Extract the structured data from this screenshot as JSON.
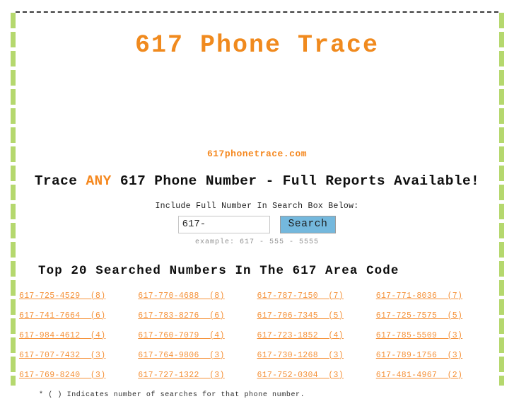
{
  "page": {
    "title": "617 Phone Trace",
    "domain_name": "617phonetrace.com",
    "tagline_before": "Trace ",
    "tagline_highlight": "ANY",
    "tagline_after": " 617 Phone Number - Full Reports Available!",
    "accent_color": "#f5881f",
    "rail_color": "#b5d86e",
    "button_color": "#74b8dd"
  },
  "search": {
    "instruction": "Include Full Number In Search Box Below:",
    "value": "617-",
    "placeholder": "617-",
    "button_label": "Search",
    "example": "example: 617 - 555 - 5555"
  },
  "top_numbers": {
    "heading": "Top 20 Searched Numbers In The 617 Area Code",
    "footnote": "* ( ) Indicates number of searches for that phone number.",
    "rows": [
      [
        {
          "number": "617-725-4529",
          "searches": "(8)",
          "label": "617-725-4529  (8)"
        },
        {
          "number": "617-770-4688",
          "searches": "(8)",
          "label": "617-770-4688  (8)"
        },
        {
          "number": "617-787-7150",
          "searches": "(7)",
          "label": "617-787-7150  (7)"
        },
        {
          "number": "617-771-8036",
          "searches": "(7)",
          "label": "617-771-8036  (7)"
        }
      ],
      [
        {
          "number": "617-741-7664",
          "searches": "(6)",
          "label": "617-741-7664  (6)"
        },
        {
          "number": "617-783-8276",
          "searches": "(6)",
          "label": "617-783-8276  (6)"
        },
        {
          "number": "617-706-7345",
          "searches": "(5)",
          "label": "617-706-7345  (5)"
        },
        {
          "number": "617-725-7575",
          "searches": "(5)",
          "label": "617-725-7575  (5)"
        }
      ],
      [
        {
          "number": "617-984-4612",
          "searches": "(4)",
          "label": "617-984-4612  (4)"
        },
        {
          "number": "617-760-7079",
          "searches": "(4)",
          "label": "617-760-7079  (4)"
        },
        {
          "number": "617-723-1852",
          "searches": "(4)",
          "label": "617-723-1852  (4)"
        },
        {
          "number": "617-785-5509",
          "searches": "(3)",
          "label": "617-785-5509  (3)"
        }
      ],
      [
        {
          "number": "617-707-7432",
          "searches": "(3)",
          "label": "617-707-7432  (3)"
        },
        {
          "number": "617-764-9806",
          "searches": "(3)",
          "label": "617-764-9806  (3)"
        },
        {
          "number": "617-730-1268",
          "searches": "(3)",
          "label": "617-730-1268  (3)"
        },
        {
          "number": "617-789-1756",
          "searches": "(3)",
          "label": "617-789-1756  (3)"
        }
      ],
      [
        {
          "number": "617-769-8240",
          "searches": "(3)",
          "label": "617-769-8240  (3)"
        },
        {
          "number": "617-727-1322",
          "searches": "(3)",
          "label": "617-727-1322  (3)"
        },
        {
          "number": "617-752-0304",
          "searches": "(3)",
          "label": "617-752-0304  (3)"
        },
        {
          "number": "617-481-4967",
          "searches": "(2)",
          "label": "617-481-4967  (2)"
        }
      ]
    ]
  }
}
